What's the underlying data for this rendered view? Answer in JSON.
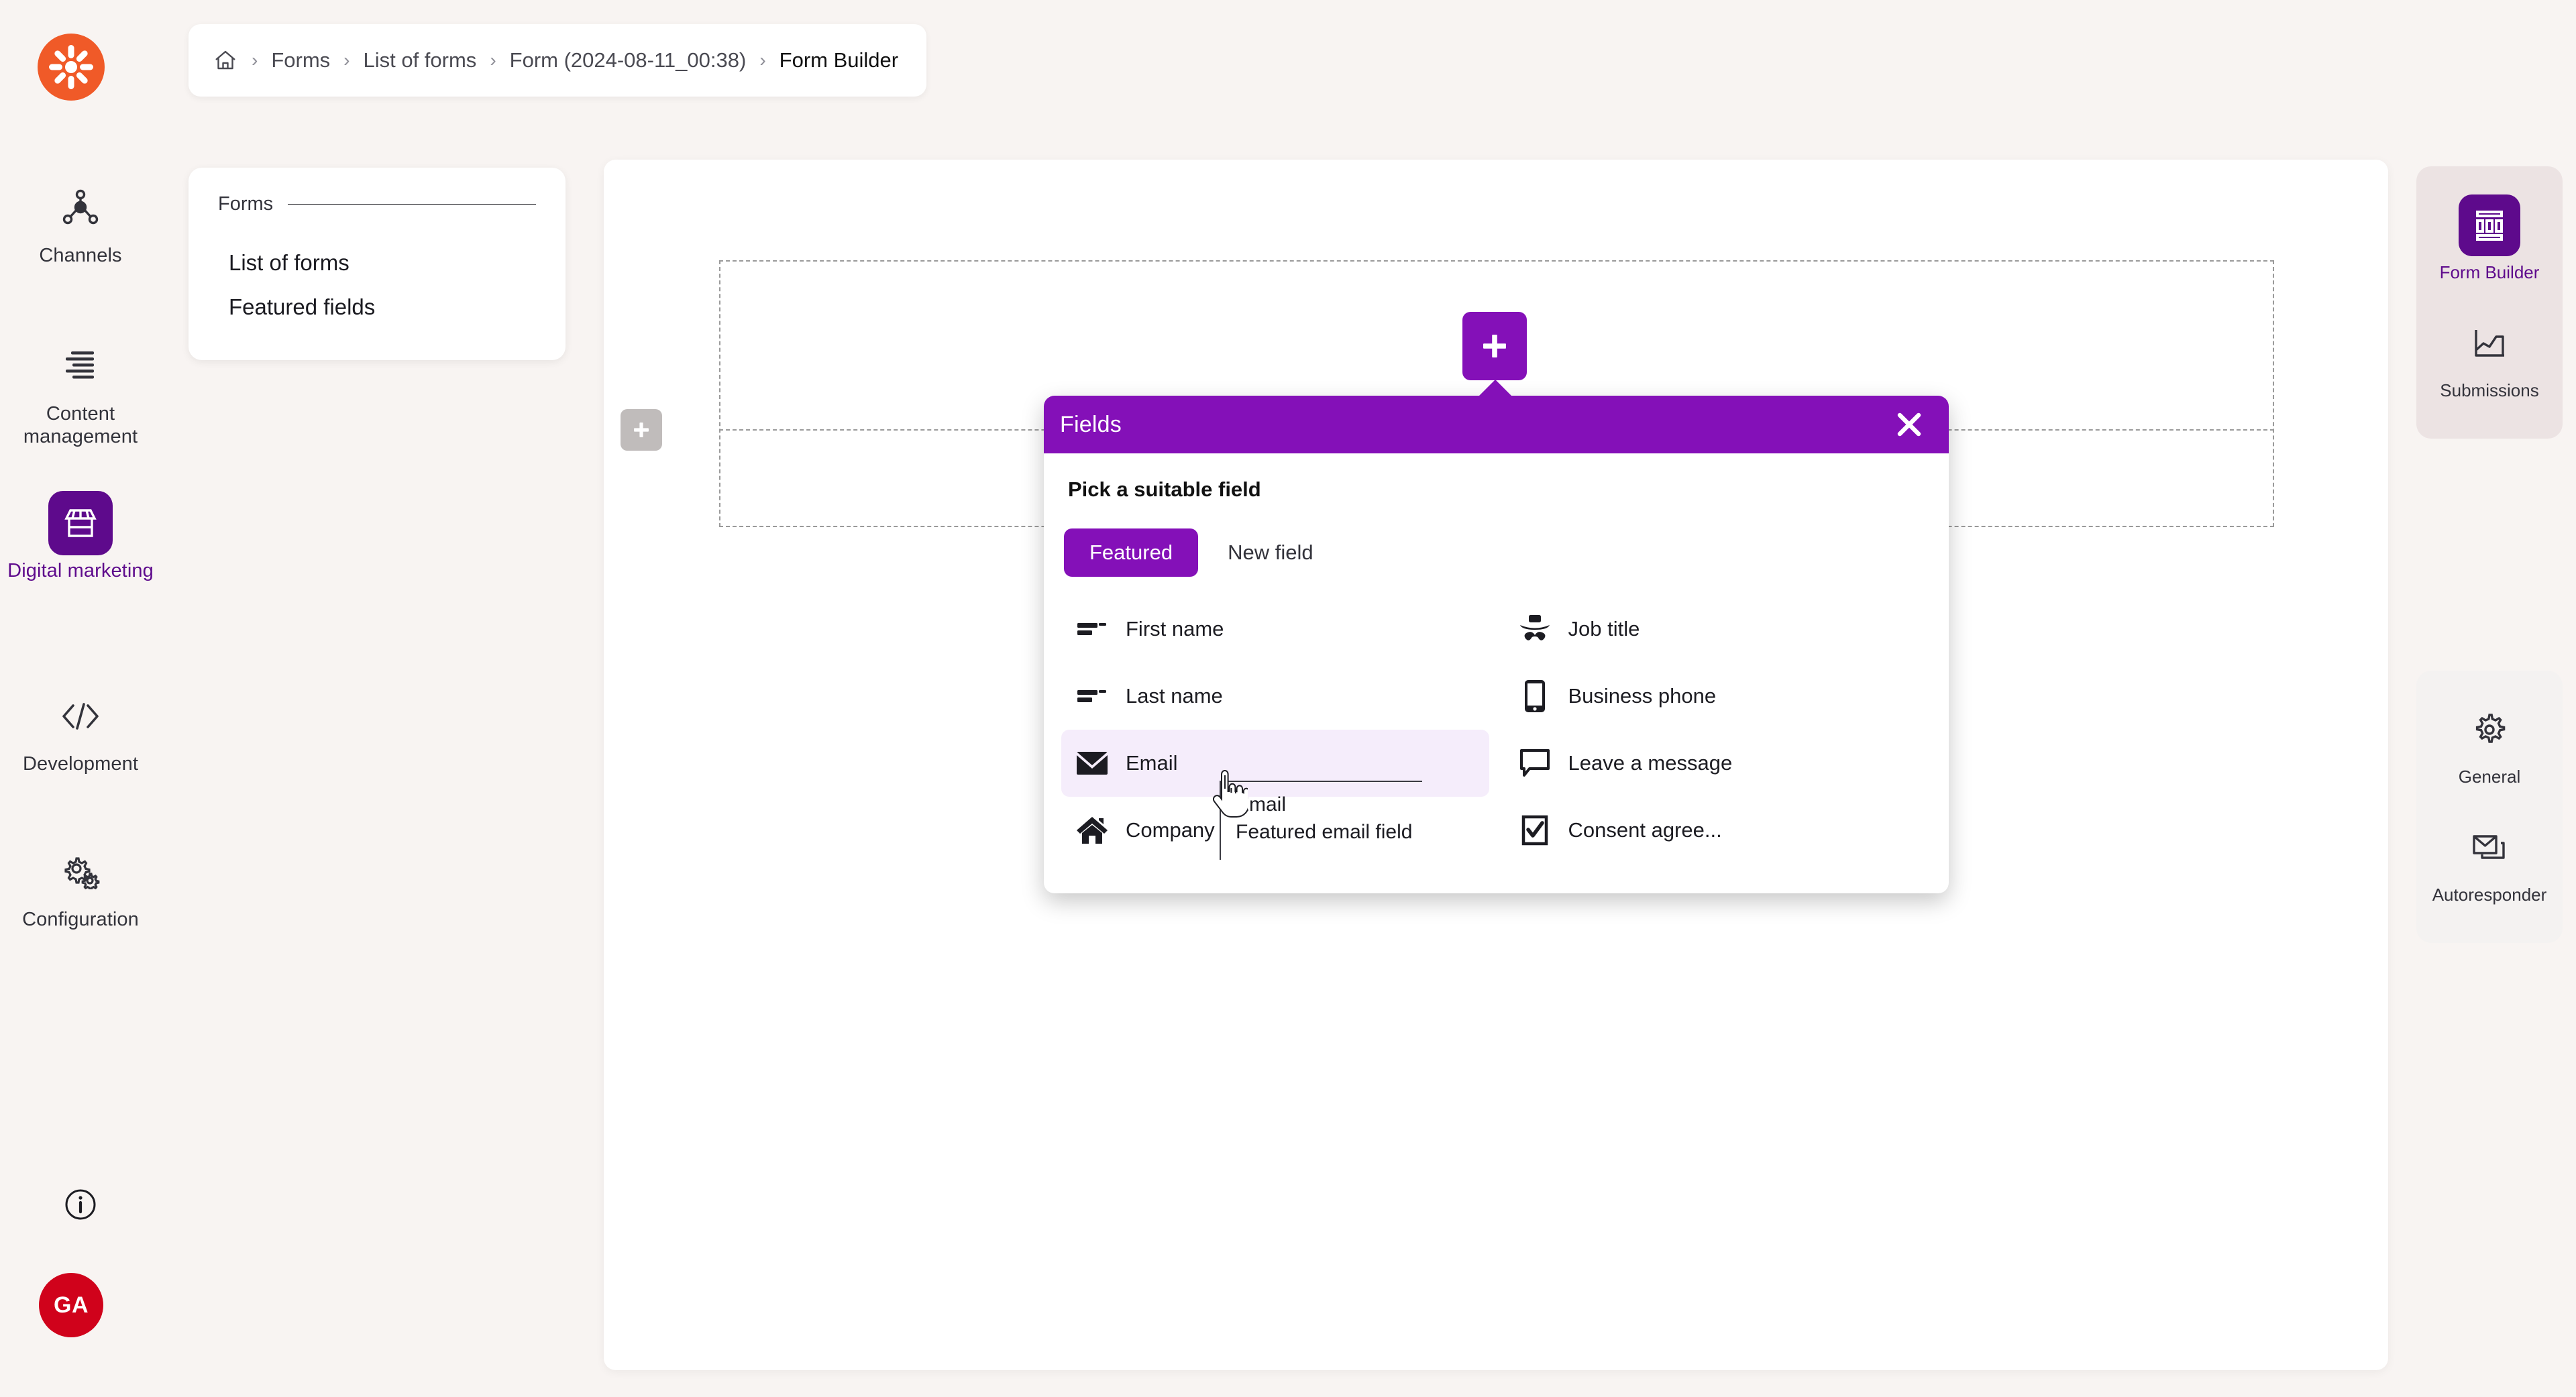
{
  "app": {
    "logo_icon": "kentico-asterisk-logo",
    "accent_purple": "#8410b8",
    "deep_purple": "#5e0a8c",
    "brand_orange": "#f05a28",
    "avatar_red": "#d0021b",
    "page_background": "#f8f4f2"
  },
  "left_rail": {
    "items": [
      {
        "label": "Channels",
        "icon": "network-nodes-icon",
        "active": false
      },
      {
        "label": "Content management",
        "icon": "content-lines-icon",
        "active": false
      },
      {
        "label": "Digital marketing",
        "icon": "storefront-icon",
        "active": true
      },
      {
        "label": "Development",
        "icon": "code-brackets-icon",
        "active": false
      },
      {
        "label": "Configuration",
        "icon": "gears-icon",
        "active": false
      }
    ],
    "info_icon": "info-circle-icon",
    "avatar_initials": "GA"
  },
  "breadcrumb": {
    "home_icon": "home-icon",
    "separator": "›",
    "items": [
      {
        "label": "Forms"
      },
      {
        "label": "List of forms"
      },
      {
        "label": "Form (2024-08-11_00:38)"
      },
      {
        "label": "Form Builder"
      }
    ]
  },
  "forms_panel": {
    "title": "Forms",
    "links": [
      {
        "label": "List of forms"
      },
      {
        "label": "Featured fields"
      }
    ]
  },
  "canvas": {
    "add_section_left_icon": "plus-icon",
    "add_field_top_icon": "plus-icon"
  },
  "fields_dialog": {
    "title": "Fields",
    "close_icon": "close-icon",
    "subtitle": "Pick a suitable field",
    "tabs": [
      {
        "label": "Featured",
        "active": true
      },
      {
        "label": "New field",
        "active": false
      }
    ],
    "fields_left": [
      {
        "label": "First name",
        "icon": "text-field-icon",
        "hovered": false
      },
      {
        "label": "Last name",
        "icon": "text-field-icon",
        "hovered": false
      },
      {
        "label": "Email",
        "icon": "envelope-icon",
        "hovered": true
      },
      {
        "label": "Company",
        "icon": "house-icon",
        "hovered": false
      }
    ],
    "fields_right": [
      {
        "label": "Job title",
        "icon": "hat-moustache-icon",
        "hovered": false
      },
      {
        "label": "Business phone",
        "icon": "mobile-phone-icon",
        "hovered": false
      },
      {
        "label": "Leave a message",
        "icon": "speech-bubble-icon",
        "hovered": false
      },
      {
        "label": "Consent agree...",
        "icon": "checkbox-checked-icon",
        "hovered": false
      }
    ],
    "tooltip": {
      "title": "Email",
      "description": "Featured email field"
    },
    "cursor_icon": "pointing-hand-cursor"
  },
  "right_rail": {
    "primary_group": [
      {
        "label": "Form Builder",
        "icon": "form-layout-icon",
        "active": true
      },
      {
        "label": "Submissions",
        "icon": "chart-area-icon",
        "active": false
      }
    ],
    "secondary_group": [
      {
        "label": "General",
        "icon": "gear-icon",
        "active": false
      },
      {
        "label": "Autoresponder",
        "icon": "mail-reply-icon",
        "active": false
      }
    ]
  }
}
